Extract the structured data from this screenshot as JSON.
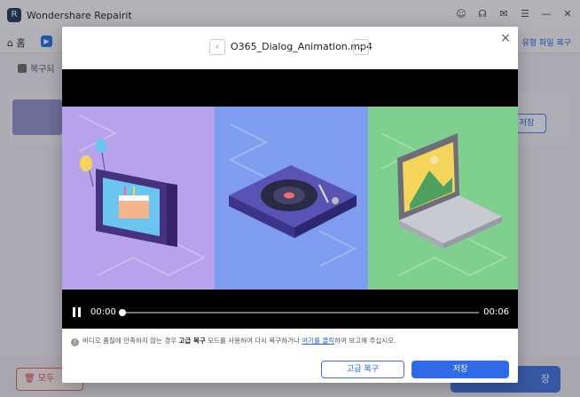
{
  "app": {
    "title": "Wondershare Repairit",
    "logo_letter": "R",
    "title_icons": [
      "user-icon",
      "headset-icon",
      "chat-icon",
      "menu-icon",
      "minimize-icon",
      "close-icon"
    ]
  },
  "nav": {
    "home_label": "홈",
    "right_text": "유형 파일 복구"
  },
  "content": {
    "section_title": "복구되",
    "file_save_label": "저장",
    "delete_all_label": "모두",
    "bottom_save_label": "장"
  },
  "modal": {
    "filename": "O365_Dialog_Animation.mp4",
    "prev_label": "‹",
    "next_label": "›",
    "close_label": "×",
    "player": {
      "current_time": "00:00",
      "end_time": "00:06",
      "progress": 0
    },
    "hint": {
      "part1": "비디오 품질에 만족하지 않는 경우 ",
      "bold": "고급 복구",
      "part2": " 모드를 사용하여 다시 복구하거나 ",
      "link": "여기를 클릭",
      "part3": "하여 보고해 주십시오."
    },
    "buttons": {
      "advanced": "고급 복구",
      "save": "저장"
    }
  },
  "colors": {
    "accent": "#2f6ae8",
    "purple_panel": "#b7a3ec",
    "blue_panel": "#7f9df0",
    "green_panel": "#7fcf8f"
  }
}
